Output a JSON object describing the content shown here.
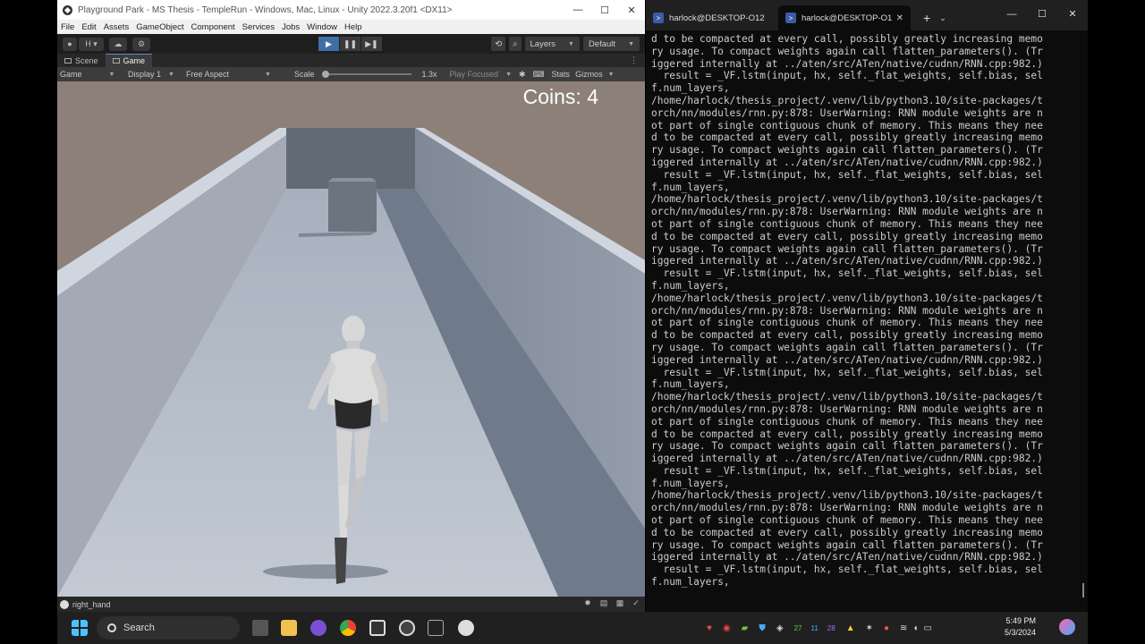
{
  "unity": {
    "window_title": "Playground Park - MS Thesis - TempleRun - Windows, Mac, Linux - Unity 2022.3.20f1 <DX11>",
    "window_controls": [
      "—",
      "☐",
      "✕"
    ],
    "menu": [
      "File",
      "Edit",
      "Assets",
      "GameObject",
      "Component",
      "Services",
      "Jobs",
      "Window",
      "Help"
    ],
    "toolbar": {
      "account": "H ▾",
      "layers": "Layers",
      "layout": "Default"
    },
    "tabs": [
      {
        "label": "Scene",
        "selected": false
      },
      {
        "label": "Game",
        "selected": true
      }
    ],
    "game_bar": {
      "mode": "Game",
      "display": "Display 1",
      "aspect": "Free Aspect",
      "scale_label": "Scale",
      "scale_value": "1.3x",
      "play_focused": "Play Focused",
      "stats": "Stats",
      "gizmos": "Gizmos"
    },
    "hud": {
      "coins": "Coins: 4"
    },
    "status_text": "right_hand"
  },
  "terminal": {
    "tabs": [
      {
        "label": "harlock@DESKTOP-O12",
        "selected": false
      },
      {
        "label": "harlock@DESKTOP-O1",
        "selected": true
      }
    ],
    "new_tab": "+",
    "dropdown": "⌄",
    "window_controls": [
      "—",
      "☐",
      "✕"
    ],
    "lines": [
      "d to be compacted at every call, possibly greatly increasing memo",
      "ry usage. To compact weights again call flatten_parameters(). (Tr",
      "iggered internally at ../aten/src/ATen/native/cudnn/RNN.cpp:982.)",
      "  result = _VF.lstm(input, hx, self._flat_weights, self.bias, sel",
      "f.num_layers,",
      "/home/harlock/thesis_project/.venv/lib/python3.10/site-packages/t",
      "orch/nn/modules/rnn.py:878: UserWarning: RNN module weights are n",
      "ot part of single contiguous chunk of memory. This means they nee",
      "d to be compacted at every call, possibly greatly increasing memo",
      "ry usage. To compact weights again call flatten_parameters(). (Tr",
      "iggered internally at ../aten/src/ATen/native/cudnn/RNN.cpp:982.)",
      "  result = _VF.lstm(input, hx, self._flat_weights, self.bias, sel",
      "f.num_layers,",
      "/home/harlock/thesis_project/.venv/lib/python3.10/site-packages/t",
      "orch/nn/modules/rnn.py:878: UserWarning: RNN module weights are n",
      "ot part of single contiguous chunk of memory. This means they nee",
      "d to be compacted at every call, possibly greatly increasing memo",
      "ry usage. To compact weights again call flatten_parameters(). (Tr",
      "iggered internally at ../aten/src/ATen/native/cudnn/RNN.cpp:982.)",
      "  result = _VF.lstm(input, hx, self._flat_weights, self.bias, sel",
      "f.num_layers,",
      "/home/harlock/thesis_project/.venv/lib/python3.10/site-packages/t",
      "orch/nn/modules/rnn.py:878: UserWarning: RNN module weights are n",
      "ot part of single contiguous chunk of memory. This means they nee",
      "d to be compacted at every call, possibly greatly increasing memo",
      "ry usage. To compact weights again call flatten_parameters(). (Tr",
      "iggered internally at ../aten/src/ATen/native/cudnn/RNN.cpp:982.)",
      "  result = _VF.lstm(input, hx, self._flat_weights, self.bias, sel",
      "f.num_layers,",
      "/home/harlock/thesis_project/.venv/lib/python3.10/site-packages/t",
      "orch/nn/modules/rnn.py:878: UserWarning: RNN module weights are n",
      "ot part of single contiguous chunk of memory. This means they nee",
      "d to be compacted at every call, possibly greatly increasing memo",
      "ry usage. To compact weights again call flatten_parameters(). (Tr",
      "iggered internally at ../aten/src/ATen/native/cudnn/RNN.cpp:982.)",
      "  result = _VF.lstm(input, hx, self._flat_weights, self.bias, sel",
      "f.num_layers,",
      "/home/harlock/thesis_project/.venv/lib/python3.10/site-packages/t",
      "orch/nn/modules/rnn.py:878: UserWarning: RNN module weights are n",
      "ot part of single contiguous chunk of memory. This means they nee",
      "d to be compacted at every call, possibly greatly increasing memo",
      "ry usage. To compact weights again call flatten_parameters(). (Tr",
      "iggered internally at ../aten/src/ATen/native/cudnn/RNN.cpp:982.)",
      "  result = _VF.lstm(input, hx, self._flat_weights, self.bias, sel",
      "f.num_layers,"
    ]
  },
  "taskbar": {
    "search_label": "Search",
    "tray_numbers": [
      "27",
      "11",
      "28"
    ],
    "time": "5:49 PM",
    "date": "5/3/2024"
  },
  "colors": {
    "unity_accent": "#3f6fa7",
    "terminal_bg": "#0c0c0c",
    "taskbar_bg": "#202020",
    "sky": "#8d8079"
  }
}
